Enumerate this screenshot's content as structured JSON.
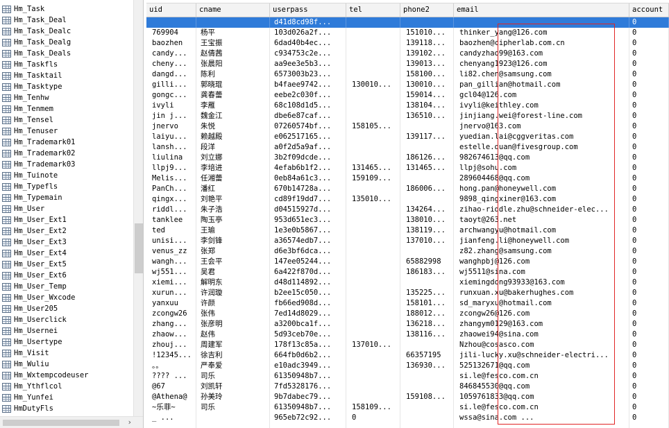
{
  "tree": {
    "items": [
      "Hm_Task",
      "Hm_Task_Deal",
      "Hm_Task_Dealc",
      "Hm_Task_Dealg",
      "Hm_Task_Deals",
      "Hm_Taskfls",
      "Hm_Tasktail",
      "Hm_Tasktype",
      "Hm_Tenhw",
      "Hm_Tenmem",
      "Hm_Tensel",
      "Hm_Tenuser",
      "Hm_Trademark01",
      "Hm_Trademark02",
      "Hm_Trademark03",
      "Hm_Tuinote",
      "Hm_Typefls",
      "Hm_Typemain",
      "Hm_User",
      "Hm_User_Ext1",
      "Hm_User_Ext2",
      "Hm_User_Ext3",
      "Hm_User_Ext4",
      "Hm_User_Ext5",
      "Hm_User_Ext6",
      "Hm_User_Temp",
      "Hm_User_Wxcode",
      "Hm_User205",
      "Hm_Userclick",
      "Hm_Usernei",
      "Hm_Usertype",
      "Hm_Visit",
      "Hm_Wuliu",
      "Hm_Wxtempcodeuser",
      "Hm_Ythflcol",
      "Hm_Yunfei",
      "HmDutyFls"
    ],
    "selected_index": 18,
    "scroll_arrow": "›"
  },
  "grid": {
    "columns": [
      "uid",
      "cname",
      "userpass",
      "tel",
      "phone2",
      "email",
      "account"
    ],
    "rows": [
      [
        "",
        "",
        "d41d8cd98f...",
        "",
        "",
        "",
        "0"
      ],
      [
        "769904",
        "杨平",
        "103d026a2f...",
        "",
        "151010...",
        "thinker_yang@126.com",
        "0"
      ],
      [
        "baozhen",
        "王宝振",
        "6dad40b4ec...",
        "",
        "139118...",
        "baozhen@cipherlab.com.cn",
        "0"
      ],
      [
        "candy...",
        "赵倩茜",
        "c934753c2e...",
        "",
        "139102...",
        "candyzhao99@163.com",
        "0"
      ],
      [
        "cheny...",
        "张晨阳",
        "aa9ee3e5b3...",
        "",
        "139013...",
        "chenyang1923@126.com",
        "0"
      ],
      [
        "dangd...",
        "陈利",
        "6573003b23...",
        "",
        "158100...",
        "li82.chen@samsung.com",
        "0"
      ],
      [
        "gilli...",
        "郭晓琨",
        "b4faee9742...",
        "130010...",
        "130010...",
        "pan_gillian@hotmail.com",
        "0"
      ],
      [
        "gongc...",
        "龚春蕾",
        "eebe2c030f...",
        "",
        "159014...",
        "gcl04@126.com",
        "0"
      ],
      [
        "ivyli",
        "李雁",
        "68c108d1d5...",
        "",
        "138104...",
        "ivyli@keithley.com",
        "0"
      ],
      [
        "jin j...",
        "魏金江",
        "dbe6e87caf...",
        "",
        "136510...",
        "jinjiang.wei@forest-line.com",
        "0"
      ],
      [
        "jnervo",
        "朱悦",
        "07260574bf...",
        "158105...",
        "",
        "jnervo@163.com",
        "0"
      ],
      [
        "laiyu...",
        "赖越殿",
        "e062517165...",
        "",
        "139117...",
        "yuedian.lai@cggveritas.com",
        "0"
      ],
      [
        "lansh...",
        "段洋",
        "a0f2d5a9af...",
        "",
        "",
        "estelle.duan@fivesgroup.com",
        "0"
      ],
      [
        "liulina",
        "刘立娜",
        "3b2f09dcde...",
        "",
        "186126...",
        "982674613@qq.com",
        "0"
      ],
      [
        "llpj9...",
        "李培进",
        "4efab6b1f2...",
        "131465...",
        "131465...",
        "llpj@sohu.com",
        "0"
      ],
      [
        "Melis...",
        "任湘蕾",
        "0eb84a61c3...",
        "159109...",
        "",
        "289604468@qq.com",
        "0"
      ],
      [
        "PanCh...",
        "潘红",
        "670b14728a...",
        "",
        "186006...",
        "hong.pan@honeywell.com",
        "0"
      ],
      [
        "qingx...",
        "刘艳平",
        "cd89f19dd7...",
        "135010...",
        "",
        "9898_qingxiner@163.com",
        "0"
      ],
      [
        "riddl...",
        "朱子浩",
        "d04515927d...",
        "",
        "134264...",
        "zihao-riddle.zhu@schneider-elec...",
        "0"
      ],
      [
        "tanklee",
        "陶玉亭",
        "953d651ec3...",
        "",
        "138010...",
        "taoyt@263.net",
        "0"
      ],
      [
        "ted",
        "王瑜",
        "1e3e0b5867...",
        "",
        "138119...",
        "archwangyu@hotmail.com",
        "0"
      ],
      [
        "unisi...",
        "李剑锋",
        "a36574edb7...",
        "",
        "137010...",
        "jianfeng.li@honeywell.com",
        "0"
      ],
      [
        "venus_zz",
        "张郑",
        "d6e3bf6dca...",
        "",
        "",
        "z82.zhang@samsung.com",
        "0"
      ],
      [
        "wangh...",
        "王会平",
        "147ee05244...",
        "",
        "65882998",
        "wanghpbj@126.com",
        "0"
      ],
      [
        "wj551...",
        "吴君",
        "6a422f870d...",
        "",
        "186183...",
        "wj5511@sina.com",
        "0"
      ],
      [
        "xiemi...",
        "解明东",
        "d48d114892...",
        "",
        "",
        "xiemingdong93933@163.com",
        "0"
      ],
      [
        "xurun...",
        "许润璇",
        "b2ee15c050...",
        "",
        "135225...",
        "runxuan.xu@bakerhughes.com",
        "0"
      ],
      [
        "yanxuu",
        "许颜",
        "fb66ed908d...",
        "",
        "158101...",
        "sd_maryxu@hotmail.com",
        "0"
      ],
      [
        "zcongw26",
        "张伟",
        "7ed14d8029...",
        "",
        "188012...",
        "zcongw26@126.com",
        "0"
      ],
      [
        "zhang...",
        "张彦明",
        "a3200bca1f...",
        "",
        "136218...",
        "zhangym0129@163.com",
        "0"
      ],
      [
        "zhaow...",
        "赵伟",
        "5d93ceb70e...",
        "",
        "138116...",
        "zhaowei94@sina.com",
        "0"
      ],
      [
        "zhouj...",
        "周建军",
        "178f13c85a...",
        "137010...",
        "",
        "Nzhou@cosasco.com",
        "0"
      ],
      [
        "!12345...",
        "徐吉利",
        "664fb0d6b2...",
        "",
        "66357195",
        "jili-lucky.xu@schneider-electri...",
        "0"
      ],
      [
        "。。",
        "严奉爱",
        "e10adc3949...",
        "",
        "136930...",
        "525132671@qq.com",
        "0"
      ],
      [
        "???? ...",
        "司乐",
        "61350948b7...",
        "",
        "",
        "si.le@fesco.com.cn",
        "0"
      ],
      [
        "@67",
        "刘凯轩",
        "7fd5328176...",
        "",
        "",
        "846845530@qq.com",
        "0"
      ],
      [
        "@Athena@",
        "孙美玲",
        "9b7dabec79...",
        "",
        "159108...",
        "1059761833@qq.com",
        "0"
      ],
      [
        "~乐菲~",
        "司乐",
        "61350948b7...",
        "158109...",
        "",
        "si.le@fesco.com.cn",
        "0"
      ],
      [
        "_  ...",
        "",
        "965eb72c92...",
        "0",
        "",
        "wssa@sina.com      ...",
        "0"
      ],
      [
        "",
        "",
        "",
        "",
        "",
        "",
        ""
      ]
    ],
    "selected_row": 0
  },
  "colors": {
    "selection": "#2f7bd9",
    "annotation": "#e02424"
  }
}
